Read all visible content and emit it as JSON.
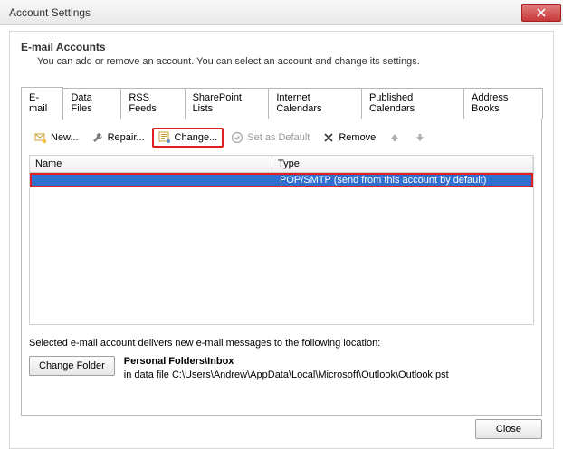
{
  "window": {
    "title": "Account Settings"
  },
  "header": {
    "title": "E-mail Accounts",
    "desc": "You can add or remove an account. You can select an account and change its settings."
  },
  "tabs": {
    "items": [
      {
        "label": "E-mail"
      },
      {
        "label": "Data Files"
      },
      {
        "label": "RSS Feeds"
      },
      {
        "label": "SharePoint Lists"
      },
      {
        "label": "Internet Calendars"
      },
      {
        "label": "Published Calendars"
      },
      {
        "label": "Address Books"
      }
    ]
  },
  "toolbar": {
    "new": "New...",
    "repair": "Repair...",
    "change": "Change...",
    "set_default": "Set as Default",
    "remove": "Remove"
  },
  "list": {
    "col_name": "Name",
    "col_type": "Type",
    "rows": [
      {
        "name": "",
        "type": "POP/SMTP (send from this account by default)"
      }
    ]
  },
  "delivery": {
    "line": "Selected e-mail account delivers new e-mail messages to the following location:",
    "change_folder": "Change Folder",
    "folder": "Personal Folders\\Inbox",
    "datafile": "in data file C:\\Users\\Andrew\\AppData\\Local\\Microsoft\\Outlook\\Outlook.pst"
  },
  "footer": {
    "close": "Close"
  }
}
